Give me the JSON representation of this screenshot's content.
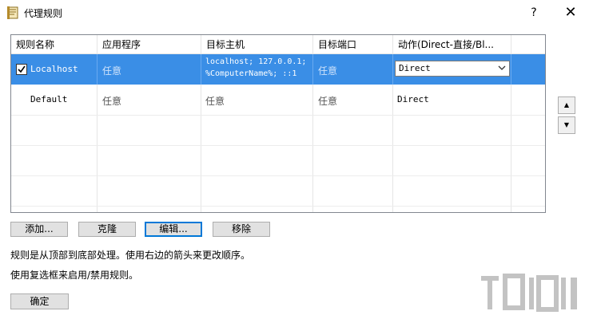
{
  "window": {
    "title": "代理规则",
    "help_label": "?",
    "close_label": "✕"
  },
  "table": {
    "columns": [
      "规则名称",
      "应用程序",
      "目标主机",
      "目标端口",
      "动作(Direct-直接/Bl..."
    ],
    "rows": [
      {
        "checked": true,
        "name": "Localhost",
        "application": "任意",
        "host_line1": "localhost; 127.0.0.1;",
        "host_line2": "%ComputerName%; ::1",
        "port": "任意",
        "action": "Direct",
        "selected": true
      },
      {
        "checked": false,
        "name": "Default",
        "application": "任意",
        "host_line1": "任意",
        "host_line2": "",
        "port": "任意",
        "action": "Direct",
        "selected": false
      }
    ]
  },
  "side_buttons": {
    "up_icon": "triangle-up-icon",
    "down_icon": "triangle-down-icon"
  },
  "buttons": {
    "add": "添加...",
    "clone": "克隆",
    "edit": "编辑...",
    "remove": "移除"
  },
  "info": {
    "line1": "规则是从顶部到底部处理。使用右边的箭头来更改顺序。",
    "line2": "使用复选框来启用/禁用规则。"
  },
  "footer": {
    "ok": "确定"
  },
  "colors": {
    "selection": "#3a8ee6",
    "border": "#828790",
    "button_bg": "#e1e1e1",
    "focus_border": "#0078d7"
  }
}
